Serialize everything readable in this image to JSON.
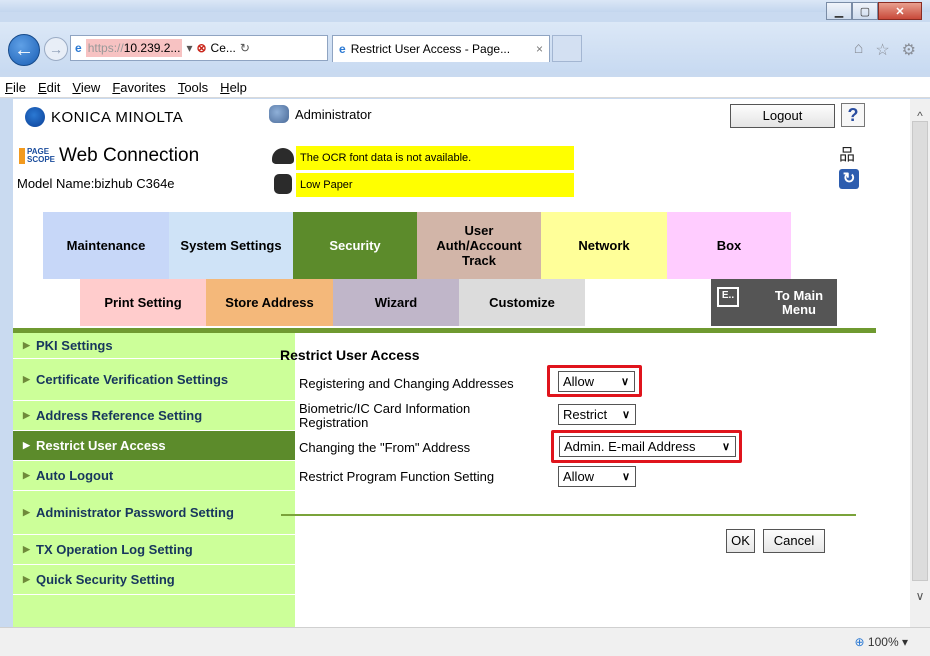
{
  "browser": {
    "url_display": "https://10.239.2...",
    "url_proto": "https://",
    "url_host": "10.239.2...",
    "cert_label": "Ce...",
    "tab_title": "Restrict User Access - Page...",
    "tab_close": "×",
    "menu": [
      "File",
      "Edit",
      "View",
      "Favorites",
      "Tools",
      "Help"
    ],
    "zoom": "100%"
  },
  "header": {
    "brand": "KONICA MINOLTA",
    "user": "Administrator",
    "logout": "Logout",
    "help": "?",
    "product_logo_top": "PAGE",
    "product_logo_bottom": "SCOPE",
    "product": "Web Connection",
    "model": "Model Name:bizhub C364e",
    "alerts": [
      "The OCR font data is not available.",
      "Low Paper"
    ]
  },
  "tabs_row1": [
    {
      "label": "Maintenance",
      "color": "#c7d7f8"
    },
    {
      "label": "System Settings",
      "color": "#cfe3f7"
    },
    {
      "label": "Security",
      "color": "#5c8b2b"
    },
    {
      "label": "User Auth/Account Track",
      "color": "#d2b5a8"
    },
    {
      "label": "Network",
      "color": "#ffff99"
    },
    {
      "label": "Box",
      "color": "#ffccff"
    }
  ],
  "tabs_row2": [
    {
      "label": "Print Setting",
      "color": "#ffcccc"
    },
    {
      "label": "Store Address",
      "color": "#f4b87a"
    },
    {
      "label": "Wizard",
      "color": "#c0b6c9"
    },
    {
      "label": "Customize",
      "color": "#dcdcdc"
    },
    {
      "label": "To Main Menu",
      "color": "#555555"
    }
  ],
  "sidebar": [
    {
      "label": "PKI Settings"
    },
    {
      "label": "Certificate Verification Settings"
    },
    {
      "label": "Address Reference Setting"
    },
    {
      "label": "Restrict User Access",
      "active": true
    },
    {
      "label": "Auto Logout"
    },
    {
      "label": "Administrator Password Setting"
    },
    {
      "label": "TX Operation Log Setting"
    },
    {
      "label": "Quick Security Setting"
    }
  ],
  "main": {
    "title": "Restrict User Access",
    "rows": [
      {
        "label": "Registering and Changing Addresses",
        "value": "Allow"
      },
      {
        "label": "Biometric/IC Card Information Registration",
        "value": "Restrict"
      },
      {
        "label": "Changing the \"From\" Address",
        "value": "Admin. E-mail Address"
      },
      {
        "label": "Restrict Program Function Setting",
        "value": "Allow"
      }
    ],
    "ok": "OK",
    "cancel": "Cancel"
  }
}
